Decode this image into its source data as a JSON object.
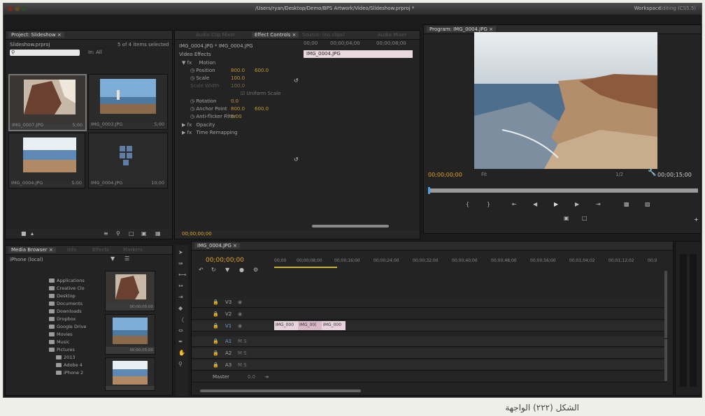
{
  "window": {
    "title": "/Users/ryan/Desktop/Demo/BPS Artwork/Video/Slideshow.prproj *",
    "workspace": "Workspace",
    "editing": "Editing (CS5.5)"
  },
  "project_panel": {
    "tab": "Project: Slideshow ×",
    "project_name": "Slideshow.prproj",
    "item_count": "5 of 4 items selected",
    "search_placeholder": "",
    "in_label": "In: All",
    "items": [
      {
        "name": "IMG_0007.JPG",
        "duration": "5;00"
      },
      {
        "name": "IMG_0003.JPG",
        "duration": "5;00"
      },
      {
        "name": "IMG_0004.JPG",
        "duration": "5;00"
      },
      {
        "name": "IMG_0004.JPG",
        "duration": "10;00"
      }
    ]
  },
  "effect_controls": {
    "tab_inactive": "Audio Clip Mixer",
    "tab": "Effect Controls ×",
    "tab_right": "Source: (no clips)",
    "tab_far": "Audio Mixer",
    "clip_path": "IMG_0004.JPG * IMG_0004.JPG",
    "video_effects": "Video Effects",
    "motion": "Motion",
    "position_label": "Position",
    "position_x": "800.0",
    "position_y": "600.0",
    "scale_label": "Scale",
    "scale_val": "100.0",
    "scale_width_label": "Scale Width",
    "scale_width_val": "100.0",
    "uniform_scale": "Uniform Scale",
    "rotation_label": "Rotation",
    "rotation_val": "0.0",
    "anchor_label": "Anchor Point",
    "anchor_x": "800.0",
    "anchor_y": "600.0",
    "antiflicker_label": "Anti-flicker Filter",
    "antiflicker_val": "0.00",
    "opacity": "Opacity",
    "time_remapping": "Time Remapping",
    "time_ruler": [
      "00;00",
      "00;00;04;00",
      "00;00;08;00"
    ],
    "clip_bar": "IMG_0004.JPG",
    "timecode": "00;00;00;00"
  },
  "program_monitor": {
    "tab": "Program: IMG_0004.JPG ×",
    "timecode": "00;00;00;00",
    "fit": "Fit",
    "zoom": "1/2",
    "duration": "00;00;15;00"
  },
  "media_browser": {
    "tab": "Media Browser ×",
    "tab2": "Info",
    "tab3": "Effects",
    "tab4": "Markers",
    "location": "iPhone (local)",
    "folders": [
      "Applications",
      "Creative Clo",
      "Desktop",
      "Documents",
      "Downloads",
      "Dropbox",
      "Google Drive",
      "Movies",
      "Music",
      "Pictures",
      "2013",
      "Adobe 4",
      "iPhone 2"
    ],
    "thumb_durations": [
      "00;00;05;00",
      "00;00;05;00",
      ""
    ]
  },
  "timeline": {
    "tab": "IMG_0004.JPG ×",
    "timecode": "00;00;00;00",
    "ruler": [
      "00;00",
      "00;00;08;00",
      "00;00;16;00",
      "00;00;24;00",
      "00;00;32;00",
      "00;00;40;00",
      "00;00;48;00",
      "00;00;56;00",
      "00;01;04;02",
      "00;01;12;02",
      "00;0"
    ],
    "tracks": [
      "V3",
      "V2",
      "V1",
      "A1",
      "A2",
      "A3",
      "Master"
    ],
    "track_labels": {
      "master_val": "0.0"
    },
    "clips": [
      "IMG_000",
      "IMG_00(",
      "IMG_000"
    ]
  },
  "caption": "الشكل (٢٢٢) الواجهة"
}
